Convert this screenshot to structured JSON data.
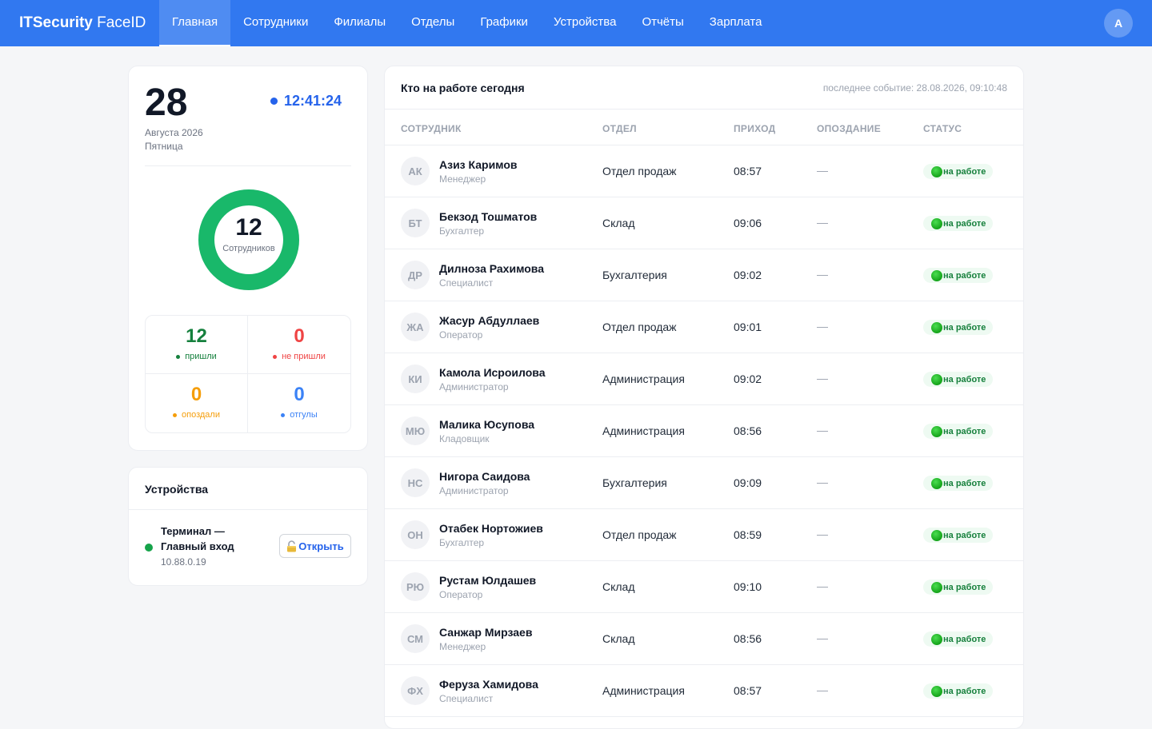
{
  "app": {
    "brand_bold": "ITSecurity",
    "brand_rest": " FaceID",
    "nav": [
      {
        "label": "Главная",
        "active": true
      },
      {
        "label": "Сотрудники"
      },
      {
        "label": "Филиалы"
      },
      {
        "label": "Отделы"
      },
      {
        "label": "Графики"
      },
      {
        "label": "Устройства"
      },
      {
        "label": "Отчёты"
      },
      {
        "label": "Зарплата"
      }
    ],
    "user_initial": "A"
  },
  "summary": {
    "day": "28",
    "time": "12:41:24",
    "month_year": "Августа 2026",
    "weekday": "Пятница",
    "total": "12",
    "total_label": "Сотрудников",
    "arrived_fraction": 1.0,
    "stats": [
      {
        "value": "12",
        "label": "пришли",
        "color": "#15803d"
      },
      {
        "value": "0",
        "label": "не пришли",
        "color": "#ef4444"
      },
      {
        "value": "0",
        "label": "опоздали",
        "color": "#f59e0b"
      },
      {
        "value": "0",
        "label": "отгулы",
        "color": "#3b82f6"
      }
    ]
  },
  "devices": {
    "title": "Устройства",
    "items": [
      {
        "name": "Терминал — Главный вход",
        "ip": "10.88.0.19",
        "button": "Открыть",
        "status_color": "#16a34a"
      }
    ]
  },
  "table": {
    "title": "Кто на работе сегодня",
    "last_event": "последнее событие: 28.08.2026, 09:10:48",
    "headers": {
      "employee": "СОТРУДНИК",
      "dept": "ОТДЕЛ",
      "arrival": "ПРИХОД",
      "late": "ОПОЗДАНИЕ",
      "status": "СТАТУС"
    },
    "rows": [
      {
        "initials": "АК",
        "name": "Азиз Каримов",
        "role": "Менеджер",
        "dept": "Отдел продаж",
        "arrival": "08:57",
        "late": "—",
        "status": "на работе"
      },
      {
        "initials": "БТ",
        "name": "Бекзод Тошматов",
        "role": "Бухгалтер",
        "dept": "Склад",
        "arrival": "09:06",
        "late": "—",
        "status": "на работе"
      },
      {
        "initials": "ДР",
        "name": "Дилноза Рахимова",
        "role": "Специалист",
        "dept": "Бухгалтерия",
        "arrival": "09:02",
        "late": "—",
        "status": "на работе"
      },
      {
        "initials": "ЖА",
        "name": "Жасур Абдуллаев",
        "role": "Оператор",
        "dept": "Отдел продаж",
        "arrival": "09:01",
        "late": "—",
        "status": "на работе"
      },
      {
        "initials": "КИ",
        "name": "Камола Исроилова",
        "role": "Администратор",
        "dept": "Администрация",
        "arrival": "09:02",
        "late": "—",
        "status": "на работе"
      },
      {
        "initials": "МЮ",
        "name": "Малика Юсупова",
        "role": "Кладовщик",
        "dept": "Администрация",
        "arrival": "08:56",
        "late": "—",
        "status": "на работе"
      },
      {
        "initials": "НС",
        "name": "Нигора Саидова",
        "role": "Администратор",
        "dept": "Бухгалтерия",
        "arrival": "09:09",
        "late": "—",
        "status": "на работе"
      },
      {
        "initials": "ОН",
        "name": "Отабек Нортожиев",
        "role": "Бухгалтер",
        "dept": "Отдел продаж",
        "arrival": "08:59",
        "late": "—",
        "status": "на работе"
      },
      {
        "initials": "РЮ",
        "name": "Рустам Юлдашев",
        "role": "Оператор",
        "dept": "Склад",
        "arrival": "09:10",
        "late": "—",
        "status": "на работе"
      },
      {
        "initials": "СМ",
        "name": "Санжар Мирзаев",
        "role": "Менеджер",
        "dept": "Склад",
        "arrival": "08:56",
        "late": "—",
        "status": "на работе"
      },
      {
        "initials": "ФХ",
        "name": "Феруза Хамидова",
        "role": "Специалист",
        "dept": "Администрация",
        "arrival": "08:57",
        "late": "—",
        "status": "на работе"
      }
    ]
  }
}
